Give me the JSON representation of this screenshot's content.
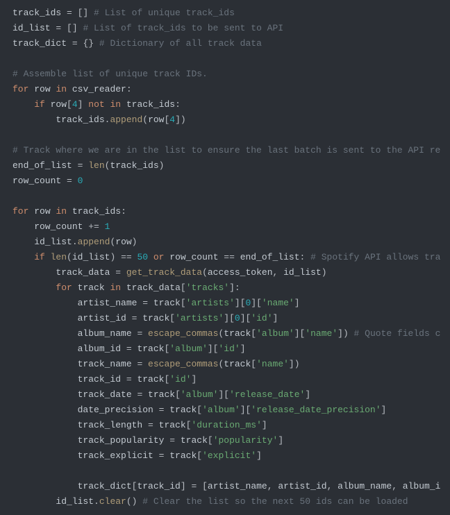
{
  "code": {
    "lines": [
      {
        "segments": [
          {
            "t": "track_ids ",
            "c": "id"
          },
          {
            "t": "= ",
            "c": "op"
          },
          {
            "t": "[] ",
            "c": "br"
          },
          {
            "t": "# List of unique track_ids",
            "c": "cm"
          }
        ]
      },
      {
        "segments": [
          {
            "t": "id_list ",
            "c": "id"
          },
          {
            "t": "= ",
            "c": "op"
          },
          {
            "t": "[] ",
            "c": "br"
          },
          {
            "t": "# List of track_ids to be sent to API",
            "c": "cm"
          }
        ]
      },
      {
        "segments": [
          {
            "t": "track_dict ",
            "c": "id"
          },
          {
            "t": "= ",
            "c": "op"
          },
          {
            "t": "{} ",
            "c": "br"
          },
          {
            "t": "# Dictionary of all track data",
            "c": "cm"
          }
        ]
      },
      {
        "segments": [
          {
            "t": " ",
            "c": "id"
          }
        ]
      },
      {
        "segments": [
          {
            "t": "# Assemble list of unique track IDs.",
            "c": "cm"
          }
        ]
      },
      {
        "segments": [
          {
            "t": "for ",
            "c": "kw"
          },
          {
            "t": "row ",
            "c": "id"
          },
          {
            "t": "in ",
            "c": "kw"
          },
          {
            "t": "csv_reader",
            "c": "id"
          },
          {
            "t": ":",
            "c": "p"
          }
        ]
      },
      {
        "segments": [
          {
            "t": "    ",
            "c": "id"
          },
          {
            "t": "if ",
            "c": "kw"
          },
          {
            "t": "row",
            "c": "id"
          },
          {
            "t": "[",
            "c": "br"
          },
          {
            "t": "4",
            "c": "num"
          },
          {
            "t": "] ",
            "c": "br"
          },
          {
            "t": "not in ",
            "c": "kw"
          },
          {
            "t": "track_ids",
            "c": "id"
          },
          {
            "t": ":",
            "c": "p"
          }
        ]
      },
      {
        "segments": [
          {
            "t": "        track_ids",
            "c": "id"
          },
          {
            "t": ".",
            "c": "p"
          },
          {
            "t": "append",
            "c": "fn"
          },
          {
            "t": "(",
            "c": "br"
          },
          {
            "t": "row",
            "c": "id"
          },
          {
            "t": "[",
            "c": "br"
          },
          {
            "t": "4",
            "c": "num"
          },
          {
            "t": "])",
            "c": "br"
          }
        ]
      },
      {
        "segments": [
          {
            "t": " ",
            "c": "id"
          }
        ]
      },
      {
        "segments": [
          {
            "t": "# Track where we are in the list to ensure the last batch is sent to the API re",
            "c": "cm"
          }
        ]
      },
      {
        "segments": [
          {
            "t": "end_of_list ",
            "c": "id"
          },
          {
            "t": "= ",
            "c": "op"
          },
          {
            "t": "len",
            "c": "fn"
          },
          {
            "t": "(",
            "c": "br"
          },
          {
            "t": "track_ids",
            "c": "id"
          },
          {
            "t": ")",
            "c": "br"
          }
        ]
      },
      {
        "segments": [
          {
            "t": "row_count ",
            "c": "id"
          },
          {
            "t": "= ",
            "c": "op"
          },
          {
            "t": "0",
            "c": "num"
          }
        ]
      },
      {
        "segments": [
          {
            "t": " ",
            "c": "id"
          }
        ]
      },
      {
        "segments": [
          {
            "t": "for ",
            "c": "kw"
          },
          {
            "t": "row ",
            "c": "id"
          },
          {
            "t": "in ",
            "c": "kw"
          },
          {
            "t": "track_ids",
            "c": "id"
          },
          {
            "t": ":",
            "c": "p"
          }
        ]
      },
      {
        "segments": [
          {
            "t": "    row_count ",
            "c": "id"
          },
          {
            "t": "+= ",
            "c": "op"
          },
          {
            "t": "1",
            "c": "num"
          }
        ]
      },
      {
        "segments": [
          {
            "t": "    id_list",
            "c": "id"
          },
          {
            "t": ".",
            "c": "p"
          },
          {
            "t": "append",
            "c": "fn"
          },
          {
            "t": "(",
            "c": "br"
          },
          {
            "t": "row",
            "c": "id"
          },
          {
            "t": ")",
            "c": "br"
          }
        ]
      },
      {
        "segments": [
          {
            "t": "    ",
            "c": "id"
          },
          {
            "t": "if ",
            "c": "kw"
          },
          {
            "t": "len",
            "c": "fn"
          },
          {
            "t": "(",
            "c": "br"
          },
          {
            "t": "id_list",
            "c": "id"
          },
          {
            "t": ") ",
            "c": "br"
          },
          {
            "t": "== ",
            "c": "op"
          },
          {
            "t": "50 ",
            "c": "num"
          },
          {
            "t": "or ",
            "c": "kw"
          },
          {
            "t": "row_count ",
            "c": "id"
          },
          {
            "t": "== ",
            "c": "op"
          },
          {
            "t": "end_of_list",
            "c": "id"
          },
          {
            "t": ": ",
            "c": "p"
          },
          {
            "t": "# Spotify API allows tra",
            "c": "cm"
          }
        ]
      },
      {
        "segments": [
          {
            "t": "        track_data ",
            "c": "id"
          },
          {
            "t": "= ",
            "c": "op"
          },
          {
            "t": "get_track_data",
            "c": "fn"
          },
          {
            "t": "(",
            "c": "br"
          },
          {
            "t": "access_token",
            "c": "id"
          },
          {
            "t": ", ",
            "c": "p"
          },
          {
            "t": "id_list",
            "c": "id"
          },
          {
            "t": ")",
            "c": "br"
          }
        ]
      },
      {
        "segments": [
          {
            "t": "        ",
            "c": "id"
          },
          {
            "t": "for ",
            "c": "kw"
          },
          {
            "t": "track ",
            "c": "id"
          },
          {
            "t": "in ",
            "c": "kw"
          },
          {
            "t": "track_data",
            "c": "id"
          },
          {
            "t": "[",
            "c": "br"
          },
          {
            "t": "'tracks'",
            "c": "str"
          },
          {
            "t": "]:",
            "c": "br"
          }
        ]
      },
      {
        "segments": [
          {
            "t": "            artist_name ",
            "c": "id"
          },
          {
            "t": "= ",
            "c": "op"
          },
          {
            "t": "track",
            "c": "id"
          },
          {
            "t": "[",
            "c": "br"
          },
          {
            "t": "'artists'",
            "c": "str"
          },
          {
            "t": "][",
            "c": "br"
          },
          {
            "t": "0",
            "c": "num"
          },
          {
            "t": "][",
            "c": "br"
          },
          {
            "t": "'name'",
            "c": "str"
          },
          {
            "t": "]",
            "c": "br"
          }
        ]
      },
      {
        "segments": [
          {
            "t": "            artist_id ",
            "c": "id"
          },
          {
            "t": "= ",
            "c": "op"
          },
          {
            "t": "track",
            "c": "id"
          },
          {
            "t": "[",
            "c": "br"
          },
          {
            "t": "'artists'",
            "c": "str"
          },
          {
            "t": "][",
            "c": "br"
          },
          {
            "t": "0",
            "c": "num"
          },
          {
            "t": "][",
            "c": "br"
          },
          {
            "t": "'id'",
            "c": "str"
          },
          {
            "t": "]",
            "c": "br"
          }
        ]
      },
      {
        "segments": [
          {
            "t": "            album_name ",
            "c": "id"
          },
          {
            "t": "= ",
            "c": "op"
          },
          {
            "t": "escape_commas",
            "c": "fn"
          },
          {
            "t": "(",
            "c": "br"
          },
          {
            "t": "track",
            "c": "id"
          },
          {
            "t": "[",
            "c": "br"
          },
          {
            "t": "'album'",
            "c": "str"
          },
          {
            "t": "][",
            "c": "br"
          },
          {
            "t": "'name'",
            "c": "str"
          },
          {
            "t": "]) ",
            "c": "br"
          },
          {
            "t": "# Quote fields c",
            "c": "cm"
          }
        ]
      },
      {
        "segments": [
          {
            "t": "            album_id ",
            "c": "id"
          },
          {
            "t": "= ",
            "c": "op"
          },
          {
            "t": "track",
            "c": "id"
          },
          {
            "t": "[",
            "c": "br"
          },
          {
            "t": "'album'",
            "c": "str"
          },
          {
            "t": "][",
            "c": "br"
          },
          {
            "t": "'id'",
            "c": "str"
          },
          {
            "t": "]",
            "c": "br"
          }
        ]
      },
      {
        "segments": [
          {
            "t": "            track_name ",
            "c": "id"
          },
          {
            "t": "= ",
            "c": "op"
          },
          {
            "t": "escape_commas",
            "c": "fn"
          },
          {
            "t": "(",
            "c": "br"
          },
          {
            "t": "track",
            "c": "id"
          },
          {
            "t": "[",
            "c": "br"
          },
          {
            "t": "'name'",
            "c": "str"
          },
          {
            "t": "])",
            "c": "br"
          }
        ]
      },
      {
        "segments": [
          {
            "t": "            track_id ",
            "c": "id"
          },
          {
            "t": "= ",
            "c": "op"
          },
          {
            "t": "track",
            "c": "id"
          },
          {
            "t": "[",
            "c": "br"
          },
          {
            "t": "'id'",
            "c": "str"
          },
          {
            "t": "]",
            "c": "br"
          }
        ]
      },
      {
        "segments": [
          {
            "t": "            track_date ",
            "c": "id"
          },
          {
            "t": "= ",
            "c": "op"
          },
          {
            "t": "track",
            "c": "id"
          },
          {
            "t": "[",
            "c": "br"
          },
          {
            "t": "'album'",
            "c": "str"
          },
          {
            "t": "][",
            "c": "br"
          },
          {
            "t": "'release_date'",
            "c": "str"
          },
          {
            "t": "]",
            "c": "br"
          }
        ]
      },
      {
        "segments": [
          {
            "t": "            date_precision ",
            "c": "id"
          },
          {
            "t": "= ",
            "c": "op"
          },
          {
            "t": "track",
            "c": "id"
          },
          {
            "t": "[",
            "c": "br"
          },
          {
            "t": "'album'",
            "c": "str"
          },
          {
            "t": "][",
            "c": "br"
          },
          {
            "t": "'release_date_precision'",
            "c": "str"
          },
          {
            "t": "]",
            "c": "br"
          }
        ]
      },
      {
        "segments": [
          {
            "t": "            track_length ",
            "c": "id"
          },
          {
            "t": "= ",
            "c": "op"
          },
          {
            "t": "track",
            "c": "id"
          },
          {
            "t": "[",
            "c": "br"
          },
          {
            "t": "'duration_ms'",
            "c": "str"
          },
          {
            "t": "]",
            "c": "br"
          }
        ]
      },
      {
        "segments": [
          {
            "t": "            track_popularity ",
            "c": "id"
          },
          {
            "t": "= ",
            "c": "op"
          },
          {
            "t": "track",
            "c": "id"
          },
          {
            "t": "[",
            "c": "br"
          },
          {
            "t": "'popularity'",
            "c": "str"
          },
          {
            "t": "]",
            "c": "br"
          }
        ]
      },
      {
        "segments": [
          {
            "t": "            track_explicit ",
            "c": "id"
          },
          {
            "t": "= ",
            "c": "op"
          },
          {
            "t": "track",
            "c": "id"
          },
          {
            "t": "[",
            "c": "br"
          },
          {
            "t": "'explicit'",
            "c": "str"
          },
          {
            "t": "]",
            "c": "br"
          }
        ]
      },
      {
        "segments": [
          {
            "t": " ",
            "c": "id"
          }
        ]
      },
      {
        "segments": [
          {
            "t": "            track_dict",
            "c": "id"
          },
          {
            "t": "[",
            "c": "br"
          },
          {
            "t": "track_id",
            "c": "id"
          },
          {
            "t": "] ",
            "c": "br"
          },
          {
            "t": "= ",
            "c": "op"
          },
          {
            "t": "[",
            "c": "br"
          },
          {
            "t": "artist_name",
            "c": "id"
          },
          {
            "t": ", ",
            "c": "p"
          },
          {
            "t": "artist_id",
            "c": "id"
          },
          {
            "t": ", ",
            "c": "p"
          },
          {
            "t": "album_name",
            "c": "id"
          },
          {
            "t": ", ",
            "c": "p"
          },
          {
            "t": "album_i",
            "c": "id"
          }
        ]
      },
      {
        "segments": [
          {
            "t": "        id_list",
            "c": "id"
          },
          {
            "t": ".",
            "c": "p"
          },
          {
            "t": "clear",
            "c": "fn"
          },
          {
            "t": "() ",
            "c": "br"
          },
          {
            "t": "# Clear the list so the next 50 ids can be loaded",
            "c": "cm"
          }
        ]
      }
    ]
  }
}
